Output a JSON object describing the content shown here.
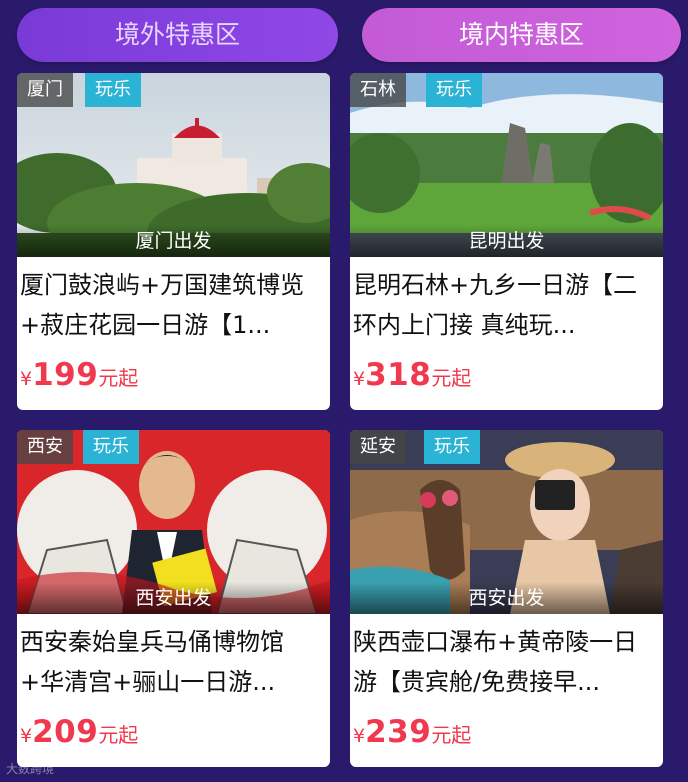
{
  "tabs": [
    {
      "label": "境外特惠区",
      "active": false
    },
    {
      "label": "境内特惠区",
      "active": true
    }
  ],
  "cards": [
    {
      "city": "厦门",
      "type": "玩乐",
      "departure": "厦门出发",
      "title": "厦门鼓浪屿+万国建筑博览+菽庄花园一日游【1...",
      "currency": "¥",
      "price": "199",
      "price_suffix": "元起"
    },
    {
      "city": "石林",
      "type": "玩乐",
      "departure": "昆明出发",
      "title": "昆明石林+九乡一日游【二环内上门接 真纯玩...",
      "currency": "¥",
      "price": "318",
      "price_suffix": "元起"
    },
    {
      "city": "西安",
      "type": "玩乐",
      "departure": "西安出发",
      "title": "西安秦始皇兵马俑博物馆+华清宫+骊山一日游...",
      "currency": "¥",
      "price": "209",
      "price_suffix": "元起"
    },
    {
      "city": "延安",
      "type": "玩乐",
      "departure": "西安出发",
      "title": "陕西壶口瀑布+黄帝陵一日游【贵宾舱/免费接早...",
      "currency": "¥",
      "price": "239",
      "price_suffix": "元起"
    }
  ],
  "watermark": "大数跨境",
  "colors": {
    "background": "#2a1a6b",
    "price": "#f0384e",
    "type_tag": "#2bb3d6"
  }
}
